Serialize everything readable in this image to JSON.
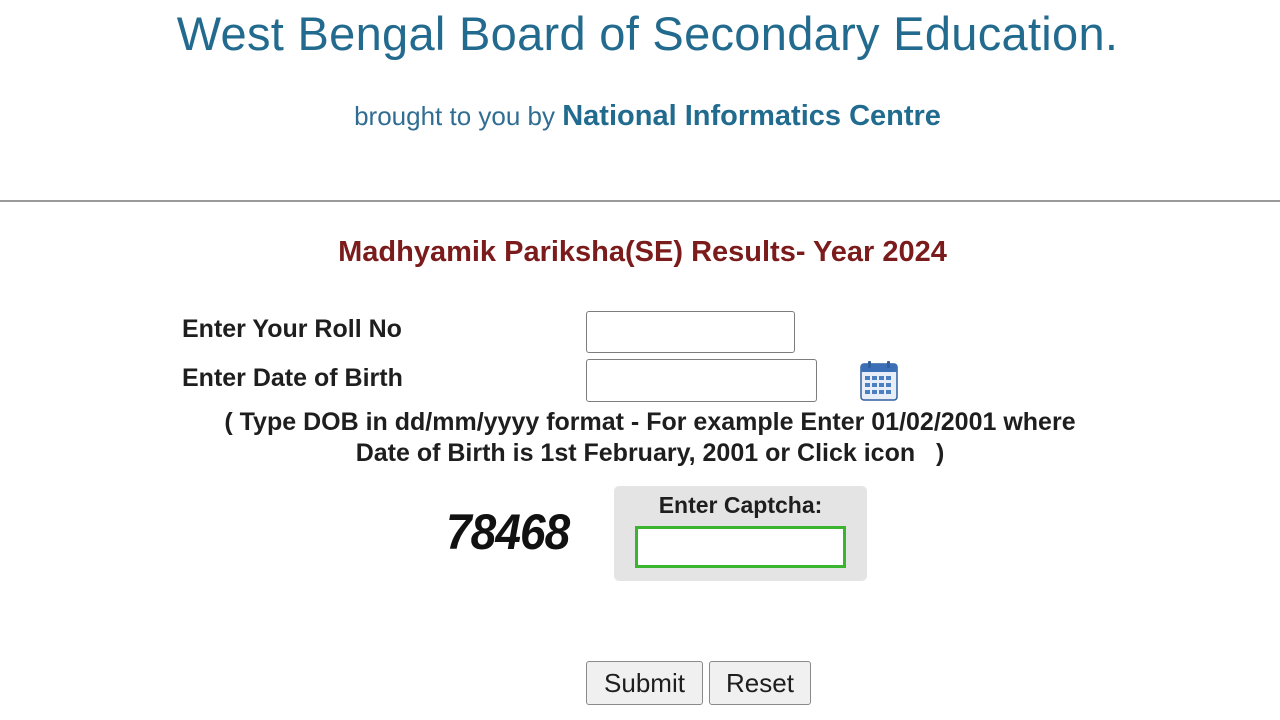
{
  "header": {
    "title": "West Bengal Board of Secondary Education.",
    "byline_prefix": "brought to you by",
    "byline_org": "National Informatics Centre"
  },
  "form": {
    "heading": "Madhyamik Pariksha(SE) Results- Year 2024",
    "roll_label": "Enter Your Roll No",
    "roll_value": "",
    "dob_label": "Enter Date of Birth",
    "dob_value": "",
    "dob_hint_line1": "( Type DOB in dd/mm/yyyy format - For example Enter 01/02/2001 where",
    "dob_hint_line2": "Date of Birth is 1st February, 2001 or Click icon   )",
    "calendar_icon": "calendar-icon",
    "captcha_code": "78468",
    "captcha_label": "Enter Captcha:",
    "captcha_value": "",
    "submit_label": "Submit",
    "reset_label": "Reset"
  },
  "colors": {
    "title": "#236b8e",
    "heading": "#7b1b1b",
    "captcha_border": "#3bb52f",
    "captcha_bg": "#e4e4e4"
  }
}
